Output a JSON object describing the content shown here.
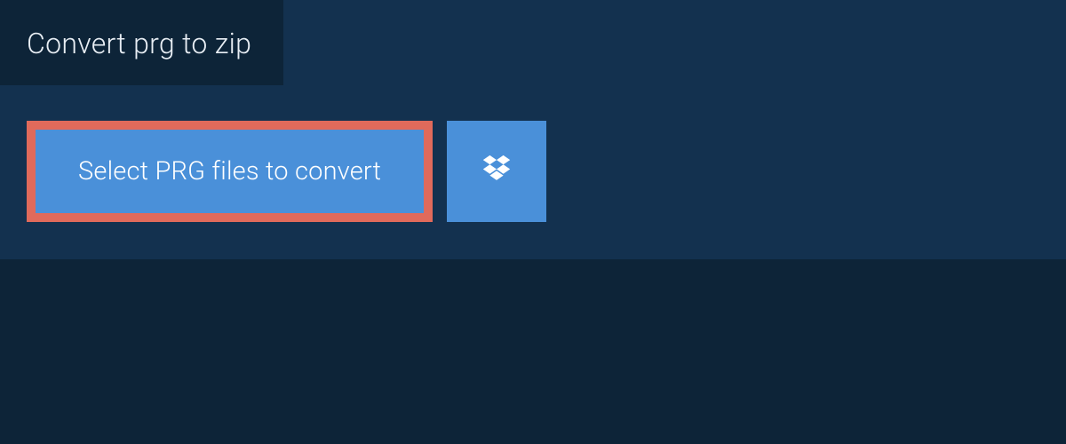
{
  "tab": {
    "label": "Convert prg to zip"
  },
  "upload": {
    "select_label": "Select PRG files to convert"
  },
  "colors": {
    "bg_dark": "#0d2438",
    "bg_panel": "#13314f",
    "button_blue": "#4a90d9",
    "highlight_border": "#e06a5b"
  }
}
